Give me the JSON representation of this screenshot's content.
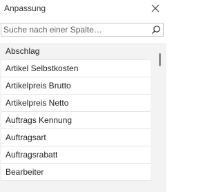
{
  "panel": {
    "title": "Anpassung",
    "close_icon": "close-icon"
  },
  "search": {
    "placeholder": "Suche nach einer Spalte…",
    "value": "",
    "icon": "search-icon"
  },
  "columns": [
    {
      "label": "Abschlag"
    },
    {
      "label": "Artikel Selbstkosten"
    },
    {
      "label": "Artikelpreis Brutto"
    },
    {
      "label": "Artikelpreis Netto"
    },
    {
      "label": "Auftrags Kennung"
    },
    {
      "label": "Auftragsart"
    },
    {
      "label": "Auftragsrabatt"
    },
    {
      "label": "Bearbeiter"
    }
  ]
}
